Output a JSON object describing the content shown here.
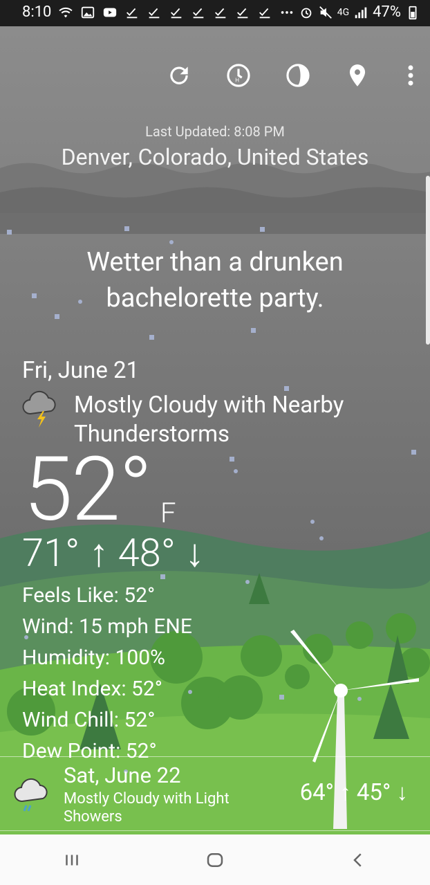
{
  "status_bar": {
    "time": "8:10",
    "network": "4G",
    "battery": "47%"
  },
  "toolbar": {
    "icons": [
      "refresh-icon",
      "hourly-clock-icon",
      "radar-icon",
      "location-pin-icon",
      "overflow-menu-icon"
    ]
  },
  "header": {
    "last_updated": "Last Updated: 8:08 PM",
    "location": "Denver, Colorado, United States"
  },
  "joke": "Wetter than a drunken bachelorette party.",
  "today": {
    "date": "Fri, June 21",
    "condition": "Mostly Cloudy with Nearby Thunderstorms",
    "temperature": "52°",
    "unit": "F",
    "high_low": "71° ↑  48° ↓",
    "details": {
      "feels_like": "Feels Like: 52°",
      "wind": "Wind: 15 mph ENE",
      "humidity": "Humidity: 100%",
      "heat_index": "Heat Index: 52°",
      "wind_chill": "Wind Chill: 52°",
      "dew_point": "Dew Point: 52°"
    }
  },
  "forecast": {
    "date": "Sat, June 22",
    "condition": "Mostly Cloudy with Light Showers",
    "high_low": "64° ↑  45° ↓"
  },
  "colors": {
    "sky_top": "#8a8a8a",
    "sky_bottom": "#5c5c5c",
    "hill_far": "#4f7d5f",
    "grass": "#6ab548",
    "nav_bar": "#fafafa"
  }
}
